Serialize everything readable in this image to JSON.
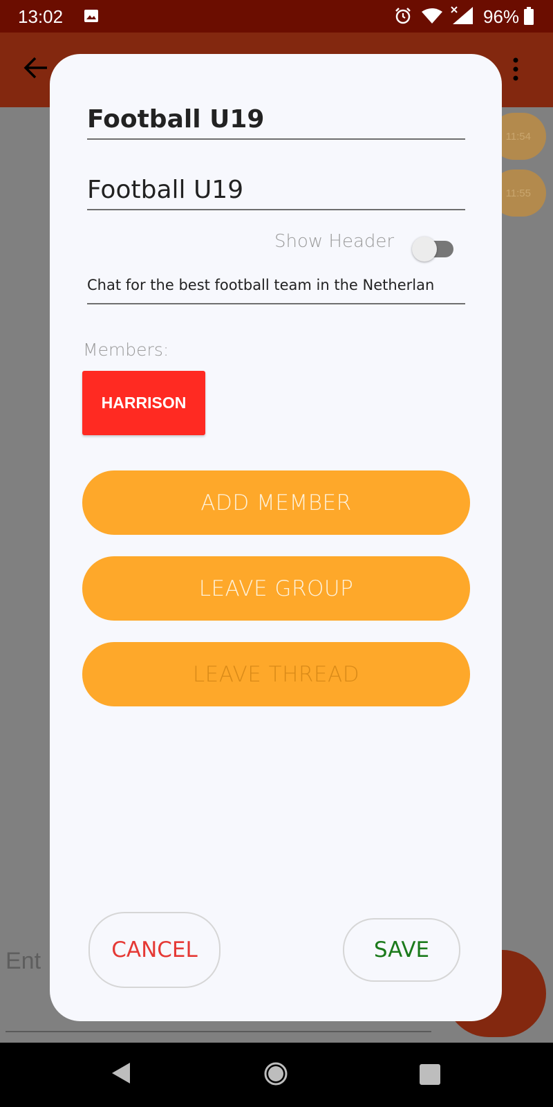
{
  "status_bar": {
    "time": "13:02",
    "battery": "96%"
  },
  "background": {
    "bubble_times": [
      "11:54",
      "11:55"
    ],
    "input_placeholder": "Ent"
  },
  "dialog": {
    "title": "Football U19",
    "name_value": "Football U19",
    "show_header_label": "Show Header",
    "show_header_on": false,
    "description": "Chat for the best football team in the Netherlan",
    "members_label": "Members:",
    "members": [
      "HARRISON"
    ],
    "add_member_label": "ADD MEMBER",
    "leave_group_label": "LEAVE GROUP",
    "leave_thread_label": "LEAVE THREAD",
    "cancel_label": "CANCEL",
    "save_label": "SAVE"
  },
  "colors": {
    "status_bar": "#6b0d00",
    "toolbar": "#83280f",
    "action_button": "#fea82a",
    "member_chip": "#ff2a22",
    "cancel_text": "#e53935",
    "save_text": "#1b7a1b"
  },
  "icons": {
    "status": [
      "image-icon",
      "alarm-icon",
      "wifi-icon",
      "signal-icon",
      "battery-icon"
    ],
    "toolbar": [
      "back-arrow-icon",
      "overflow-menu-icon"
    ],
    "nav": [
      "nav-back-icon",
      "nav-home-icon",
      "nav-recents-icon"
    ]
  }
}
